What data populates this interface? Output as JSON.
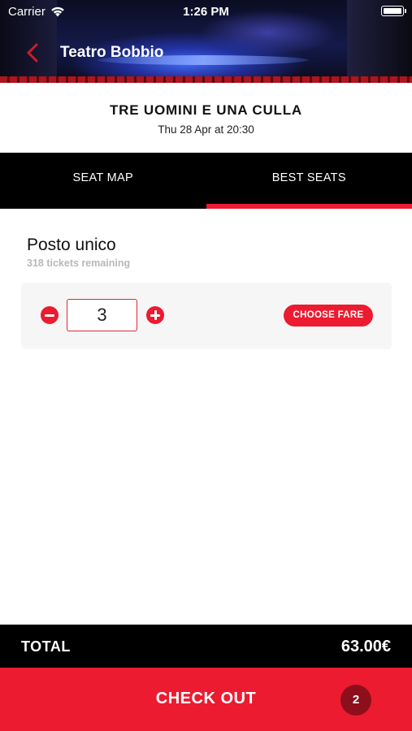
{
  "status_bar": {
    "carrier": "Carrier",
    "time": "1:26 PM"
  },
  "header": {
    "title": "Teatro Bobbio"
  },
  "event": {
    "title": "TRE UOMINI E UNA CULLA",
    "date": "Thu 28 Apr at 20:30"
  },
  "tabs": [
    {
      "label": "SEAT MAP",
      "active": false
    },
    {
      "label": "BEST SEATS",
      "active": true
    }
  ],
  "ticket": {
    "name": "Posto unico",
    "remaining": "318 tickets remaining",
    "quantity": "3",
    "choose_fare_label": "CHOOSE FARE"
  },
  "footer": {
    "total_label": "TOTAL",
    "total_value": "63.00€",
    "checkout_label": "CHECK OUT",
    "cart_count": "2"
  },
  "colors": {
    "accent": "#ec1b30",
    "dark": "#000000",
    "badge": "#8c0f1b"
  },
  "icons": [
    "wifi-icon",
    "battery-icon",
    "back-chevron-icon",
    "minus-icon",
    "plus-icon"
  ]
}
